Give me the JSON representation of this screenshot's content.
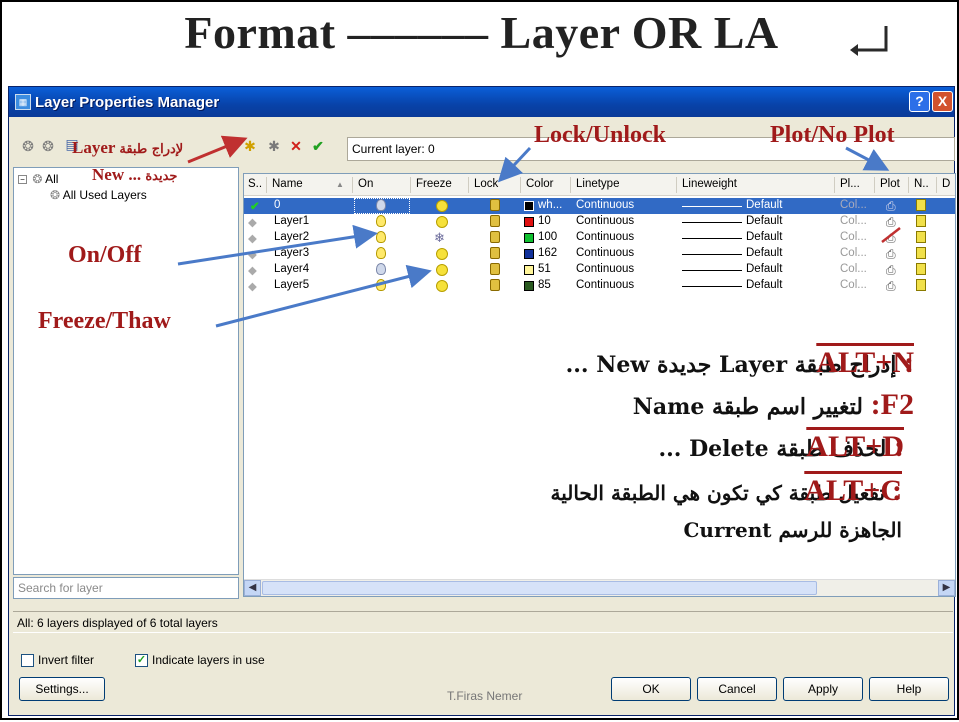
{
  "slide": {
    "title": "Format –––––– Layer   OR   LA"
  },
  "window": {
    "title": "Layer Properties Manager",
    "help_label": "?",
    "close_label": "X"
  },
  "toolbar": {
    "current_layer": "Current layer: 0"
  },
  "tree": {
    "all_label": "All",
    "used_label": "All Used Layers"
  },
  "grid": {
    "headers": [
      "S..",
      "Name",
      "On",
      "Freeze",
      "Lock",
      "Color",
      "Linetype",
      "Lineweight",
      "Pl...",
      "Plot",
      "N..",
      "D"
    ],
    "rows": [
      {
        "name": "0",
        "color_name": "wh...",
        "color": "#000000",
        "linetype": "Continuous",
        "lineweight": "Default",
        "plotstyle": "Col..."
      },
      {
        "name": "Layer1",
        "color_name": "10",
        "color": "#e01010",
        "linetype": "Continuous",
        "lineweight": "Default",
        "plotstyle": "Col..."
      },
      {
        "name": "Layer2",
        "color_name": "100",
        "color": "#10c030",
        "linetype": "Continuous",
        "lineweight": "Default",
        "plotstyle": "Col..."
      },
      {
        "name": "Layer3",
        "color_name": "162",
        "color": "#10309a",
        "linetype": "Continuous",
        "lineweight": "Default",
        "plotstyle": "Col..."
      },
      {
        "name": "Layer4",
        "color_name": "51",
        "color": "#fff59a",
        "linetype": "Continuous",
        "lineweight": "Default",
        "plotstyle": "Col..."
      },
      {
        "name": "Layer5",
        "color_name": "85",
        "color": "#2a5a20",
        "linetype": "Continuous",
        "lineweight": "Default",
        "plotstyle": "Col..."
      }
    ]
  },
  "search": {
    "placeholder": "Search for layer"
  },
  "status": {
    "text": "All: 6 layers displayed of 6 total layers"
  },
  "options": {
    "invert_filter": "Invert filter",
    "indicate_layers": "Indicate layers in use"
  },
  "buttons": {
    "settings": "Settings...",
    "ok": "OK",
    "cancel": "Cancel",
    "apply": "Apply",
    "help": "Help"
  },
  "credit": "T.Firas Nemer",
  "annotations": {
    "new_layer_ar": "لإدراج طبقة",
    "new_layer_en": "Layer",
    "new_ar": "جديدة",
    "new_en": "New ...",
    "lock": "Lock/Unlock",
    "plot": "Plot/No Plot",
    "onoff": "On/Off",
    "freeze": "Freeze/Thaw"
  },
  "notes": [
    {
      "key": "ALT+N",
      "text": "إدراج طبقة Layer جديدة New ...",
      "sep": ":"
    },
    {
      "key": "F2",
      "text": "لتغيير اسم طبقة Name",
      "sep": ":"
    },
    {
      "key": "ALT+D",
      "text": "لحذف طبقة Delete ...",
      "sep": ":"
    },
    {
      "key": "ALT+C",
      "text": "تفعيل طبقة كي تكون هي الطبقة الحالية",
      "sep": ":"
    },
    {
      "key": "",
      "text": "الجاهزة للرسم Current",
      "sep": ""
    }
  ]
}
